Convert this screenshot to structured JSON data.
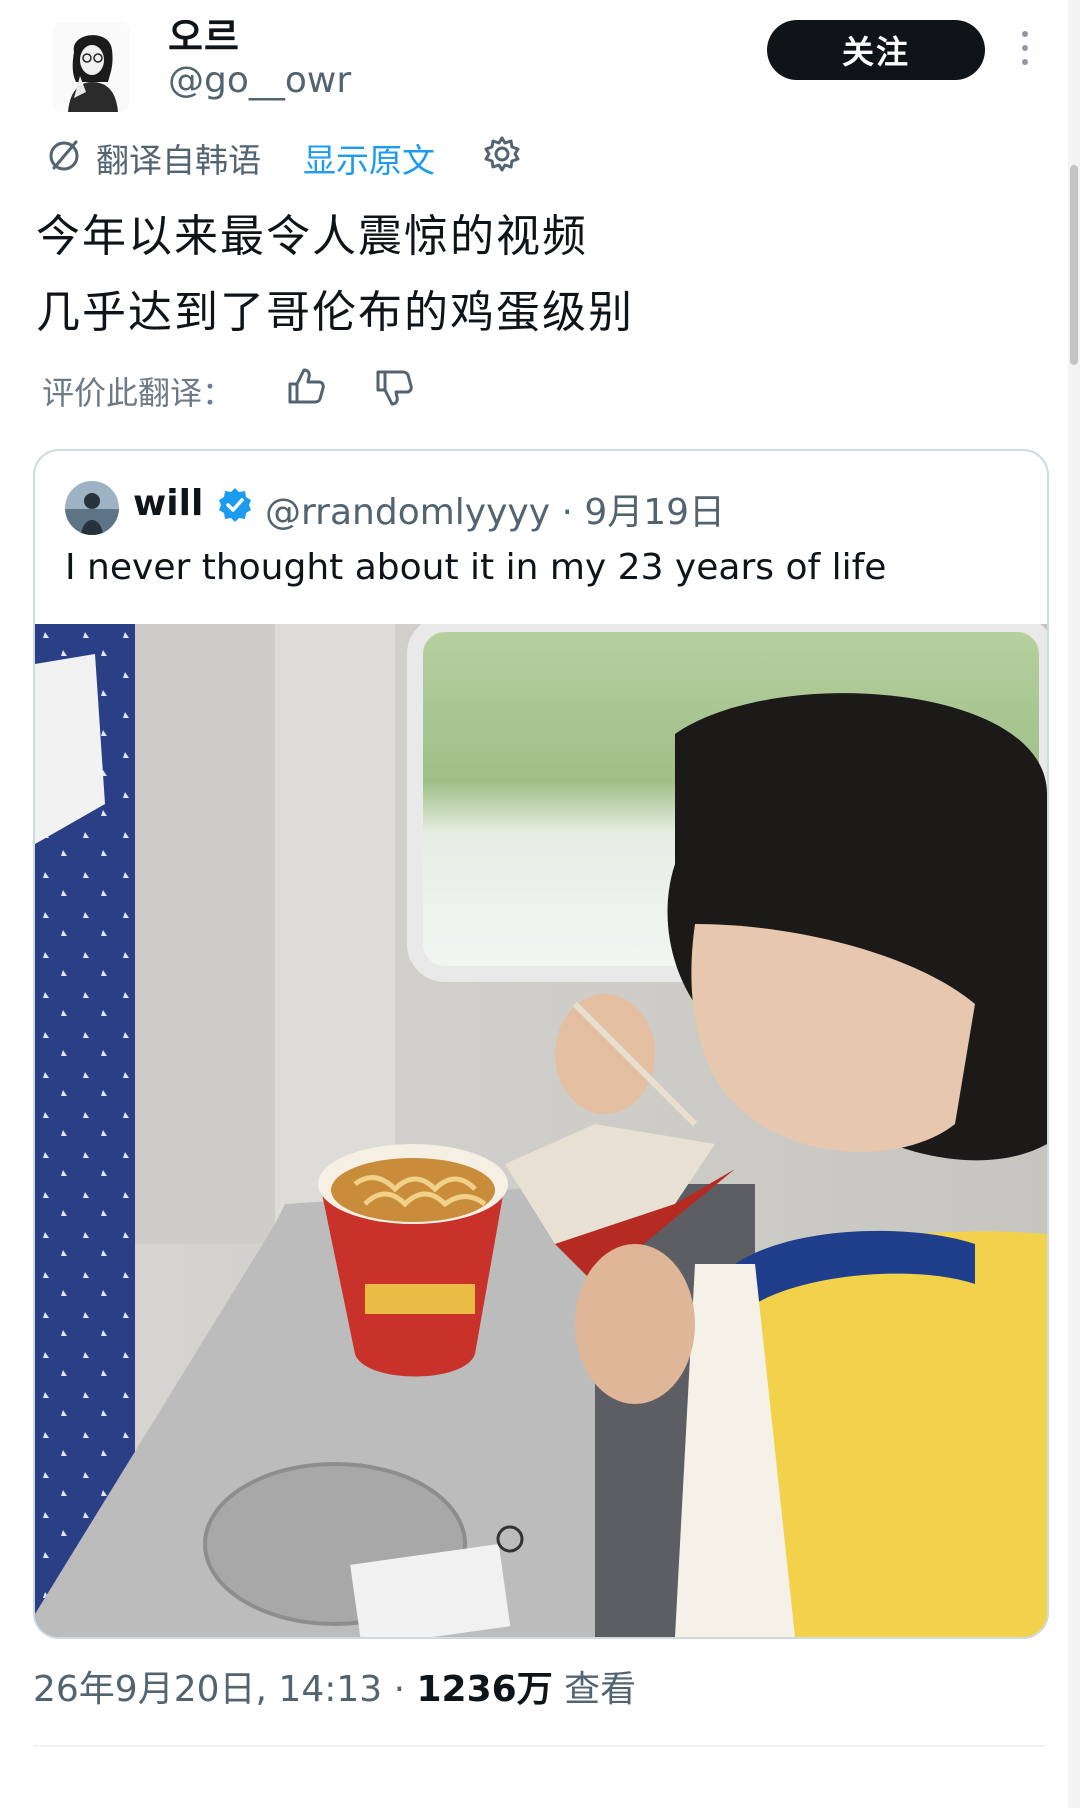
{
  "author": {
    "display_name": "오르",
    "handle": "@go__owr",
    "follow_label": "关注"
  },
  "translation": {
    "translated_from": "翻译自韩语",
    "show_original": "显示原文"
  },
  "tweet": {
    "lines": [
      "今年以来最令人震惊的视频",
      "几乎达到了哥伦布的鸡蛋级别"
    ]
  },
  "rating": {
    "label": "评价此翻译："
  },
  "quoted": {
    "display_name": "will",
    "handle_date": "@rrandomlyyyy · 9月19日",
    "text": "I never thought about it in my 23 years of life"
  },
  "meta": {
    "timestamp": "26年9月20日, 14:13 · ",
    "views_count": "1236万",
    "views_label": " 查看"
  },
  "icons": {
    "more": "more-vertical-icon",
    "translate": "translate-icon",
    "settings": "gear-icon",
    "verified": "verified-badge-icon",
    "mute": "muted-speaker-icon"
  },
  "colors": {
    "link": "#1d9bf0",
    "verified": "#1d9bf0",
    "follow_bg": "#0f1419"
  }
}
